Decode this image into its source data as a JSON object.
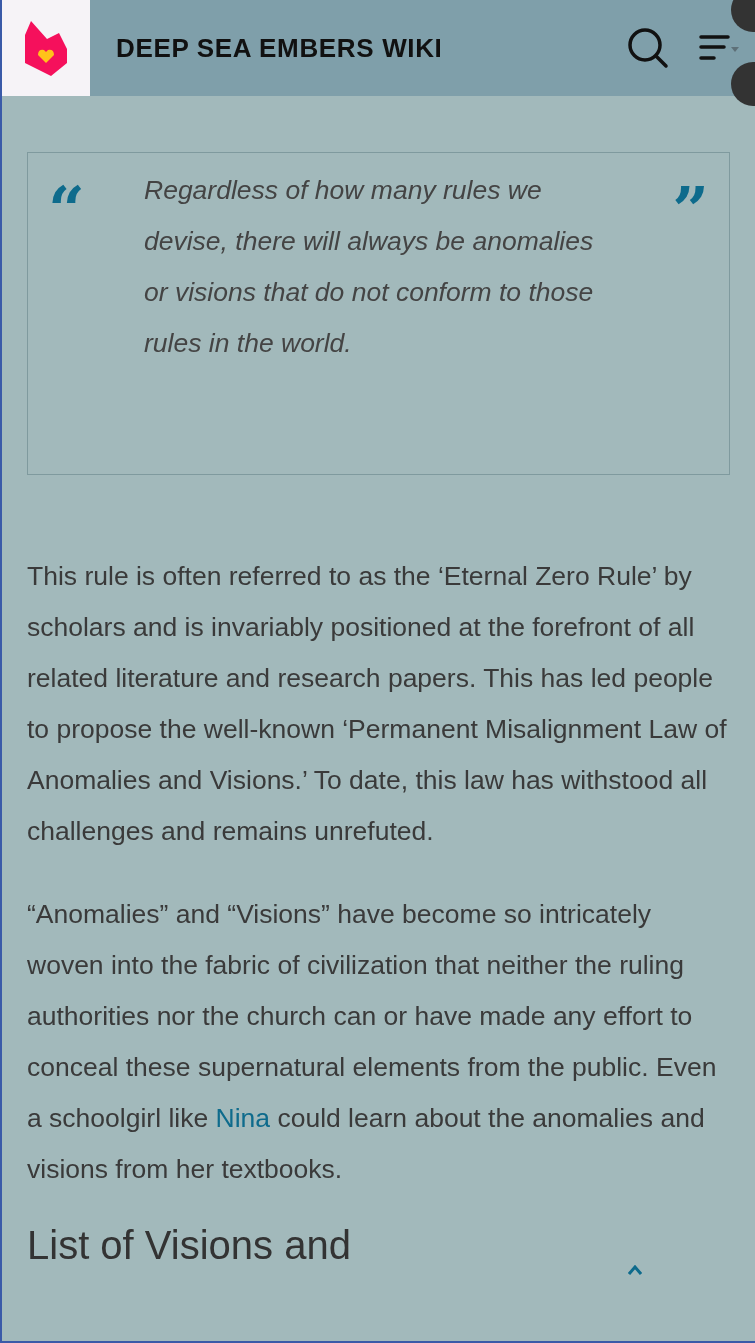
{
  "header": {
    "title": "DEEP SEA EMBERS WIKI"
  },
  "quote": {
    "open_mark": "“",
    "text": "Regardless of how many rules we devise, there will always be anomalies or visions that do not conform to those rules in the world.",
    "close_mark": "”"
  },
  "paragraphs": [
    [
      {
        "text": "This rule is often referred to as the ‘Eternal Zero Rule’ by scholars and is invariably positioned at the forefront of all related literature and research papers. This has led people to propose the well-known ‘Permanent Misalignment Law of Anomalies and Visions.’ To date, this law has withstood all challenges and remains unrefuted.",
        "kind": "text"
      }
    ],
    [
      {
        "text": "“Anomalies” and “Visions” have become so intricately woven into the fabric of civilization that neither the ruling authorities nor the church can or have made any effort to conceal these supernatural elements from the public. Even a schoolgirl like ",
        "kind": "text"
      },
      {
        "text": "Nina",
        "kind": "link"
      },
      {
        "text": " could learn about the anomalies and visions from her textbooks.",
        "kind": "text"
      }
    ]
  ],
  "section_heading": "List of Visions and"
}
